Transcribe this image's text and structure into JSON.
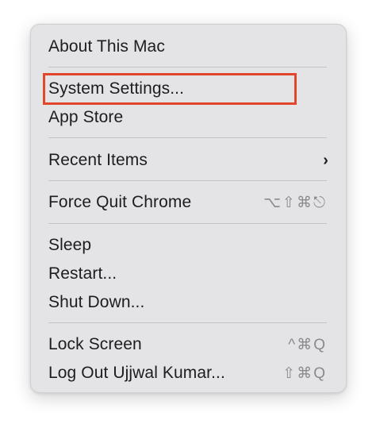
{
  "menu": {
    "about": "About This Mac",
    "system_settings": "System Settings...",
    "app_store": "App Store",
    "recent_items": "Recent Items",
    "recent_items_arrow": "›",
    "force_quit": "Force Quit Chrome",
    "force_quit_shortcut": "⌥⇧⌘⎋",
    "sleep": "Sleep",
    "restart": "Restart...",
    "shut_down": "Shut Down...",
    "lock_screen": "Lock Screen",
    "lock_screen_shortcut": "^⌘Q",
    "log_out": "Log Out Ujjwal Kumar...",
    "log_out_shortcut": "⇧⌘Q"
  },
  "colors": {
    "menu_background": "#e4e4e6",
    "text": "#1d1d1f",
    "shortcut_text": "#8a8a8e",
    "highlight_border": "#e0472b"
  }
}
